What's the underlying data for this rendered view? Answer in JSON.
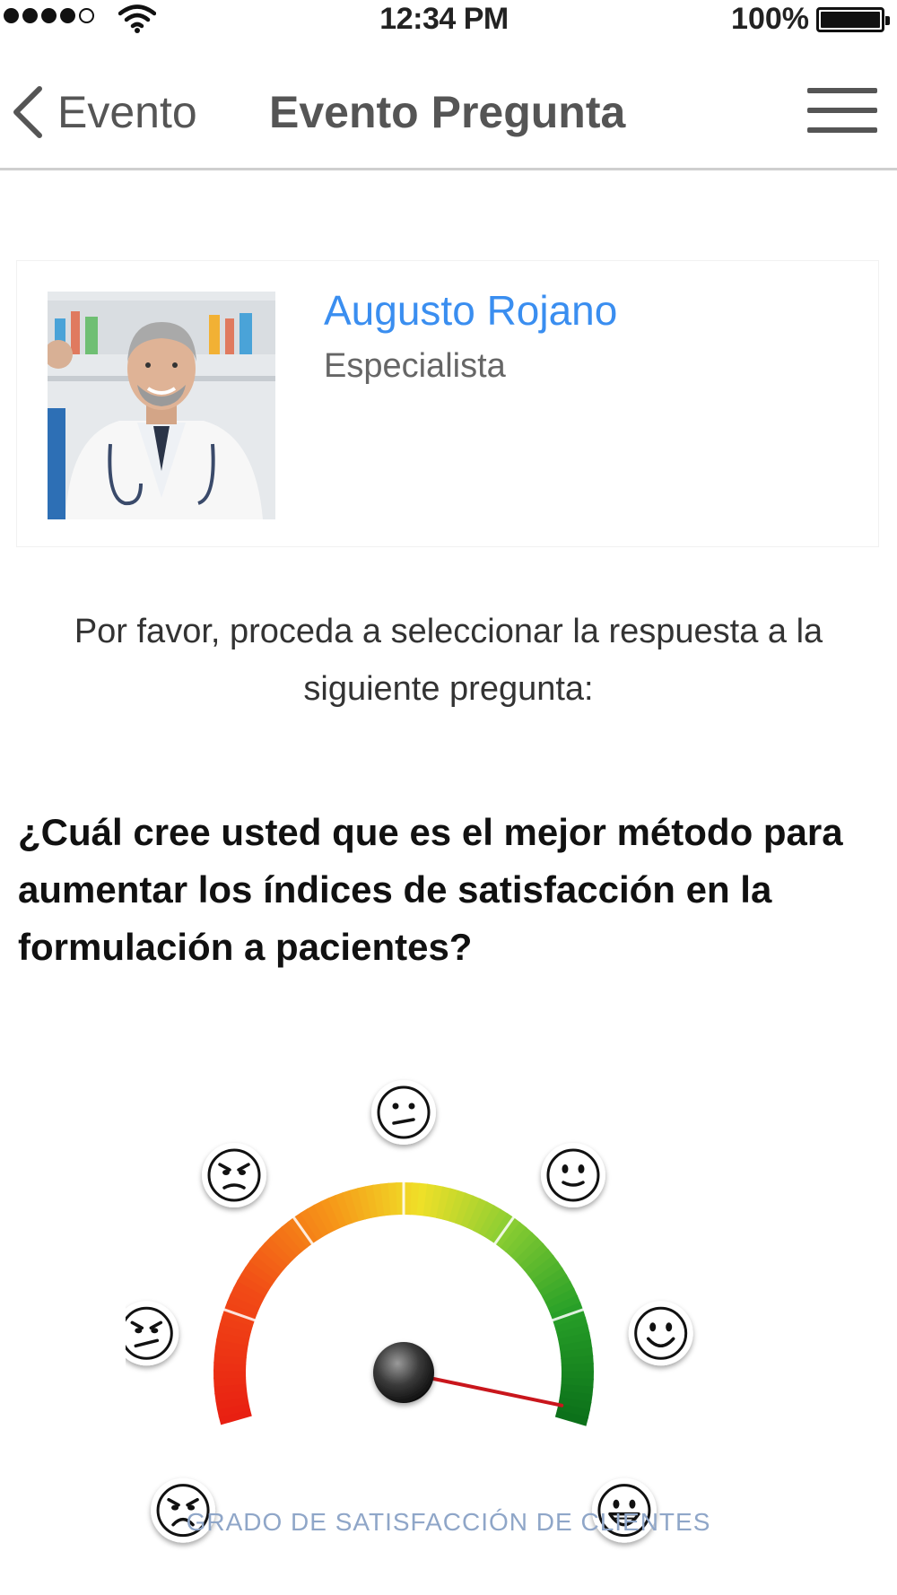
{
  "status_bar": {
    "time": "12:34 PM",
    "battery": "100%"
  },
  "nav": {
    "back_label": "Evento",
    "title": "Evento Pregunta"
  },
  "profile": {
    "name": "Augusto Rojano",
    "role": "Especialista"
  },
  "instruction": "Por favor, proceda a seleccionar la respuesta a la siguiente pregunta:",
  "question": "¿Cuál cree usted que es el mejor método para aumentar los índices de satisfacción en la formulación a pacientes?",
  "gauge": {
    "caption": "GRADO DE SATISFACCIÓN DE CLIENTES",
    "needle_value_fraction": 0.98,
    "faces": [
      "very-angry-face",
      "angry-face",
      "frowning-face",
      "neutral-face",
      "slight-smile-face",
      "smiling-face",
      "grinning-face"
    ],
    "colors": {
      "accent": "#3a8ef0"
    }
  }
}
